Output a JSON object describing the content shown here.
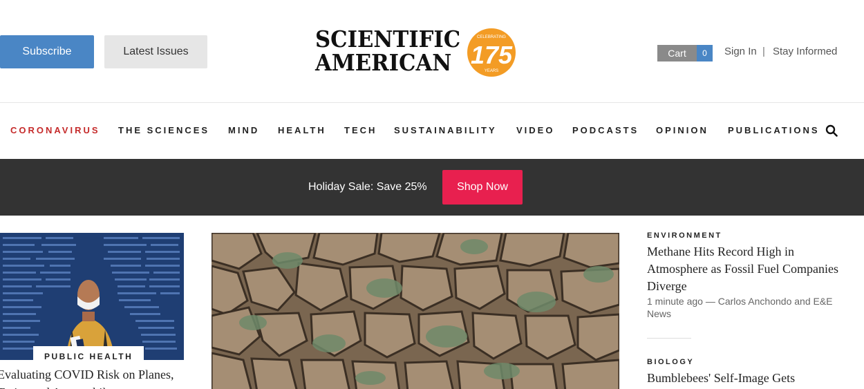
{
  "header": {
    "subscribe_label": "Subscribe",
    "latest_issues_label": "Latest Issues",
    "logo": {
      "line1": "SCIENTIFIC",
      "line2": "AMERICAN",
      "badge_top": "CELEBRATING",
      "badge_number": "175",
      "badge_bottom": "YEARS"
    },
    "cart_label": "Cart",
    "cart_count": "0",
    "signin_label": "Sign In",
    "separator": "|",
    "stay_informed_label": "Stay Informed"
  },
  "nav": {
    "items": [
      {
        "label": "CORONAVIRUS"
      },
      {
        "label": "THE SCIENCES"
      },
      {
        "label": "MIND"
      },
      {
        "label": "HEALTH"
      },
      {
        "label": "TECH"
      },
      {
        "label": "SUSTAINABILITY"
      },
      {
        "label": "VIDEO"
      },
      {
        "label": "PODCASTS"
      },
      {
        "label": "OPINION"
      },
      {
        "label": "PUBLICATIONS"
      }
    ],
    "search_icon": "search-icon"
  },
  "banner": {
    "text": "Holiday Sale: Save 25%",
    "button_label": "Shop Now"
  },
  "stories": {
    "left": {
      "tag": "PUBLIC HEALTH",
      "title": "Evaluating COVID Risk on Planes, Trains and Automobiles"
    },
    "right": [
      {
        "kicker": "ENVIRONMENT",
        "title": "Methane Hits Record High in Atmosphere as Fossil Fuel Companies Diverge",
        "meta": "1 minute ago — Carlos Anchondo and E&E News"
      },
      {
        "kicker": "BIOLOGY",
        "title": "Bumblebees' Self-Image Gets"
      }
    ]
  },
  "colors": {
    "subscribe": "#4a86c5",
    "nav_highlight": "#c52a2a",
    "banner_bg": "#333333",
    "shop_now": "#e8204f",
    "badge": "#f39c25"
  }
}
